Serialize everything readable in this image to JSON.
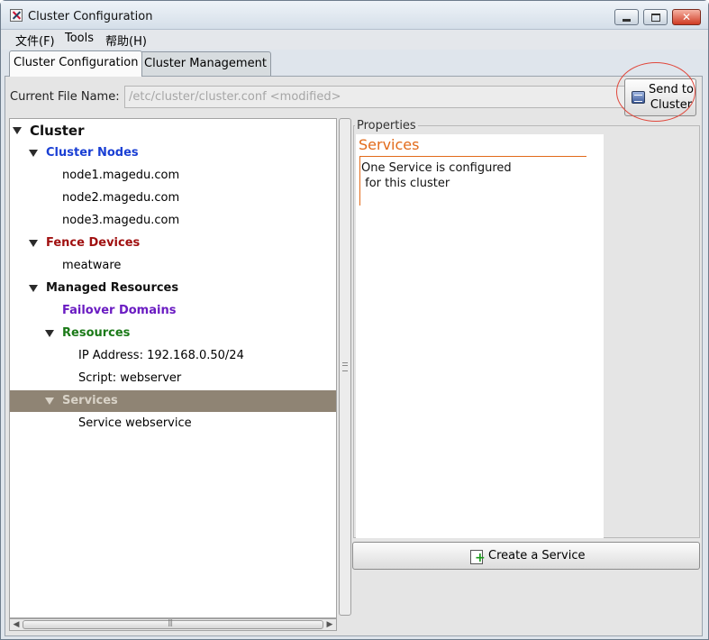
{
  "window": {
    "title": "Cluster Configuration"
  },
  "menu": {
    "items": [
      {
        "label": "文件(F)"
      },
      {
        "label": "Tools"
      },
      {
        "label": "帮助(H)"
      }
    ]
  },
  "tabs": [
    {
      "label": "Cluster Configuration",
      "active": true
    },
    {
      "label": "Cluster Management",
      "active": false
    }
  ],
  "file": {
    "label": "Current File Name:",
    "value": "/etc/cluster/cluster.conf <modified>"
  },
  "send_button": {
    "line1": "Send to",
    "line2": "Cluster"
  },
  "tree": {
    "root": "Cluster",
    "cluster_nodes": "Cluster Nodes",
    "nodes": [
      "node1.magedu.com",
      "node2.magedu.com",
      "node3.magedu.com"
    ],
    "fence_devices": "Fence Devices",
    "fence_items": [
      "meatware"
    ],
    "managed_resources": "Managed Resources",
    "failover_domains": "Failover Domains",
    "resources": "Resources",
    "resource_items": [
      "IP Address:  192.168.0.50/24",
      "Script:  webserver"
    ],
    "services": "Services",
    "service_items": [
      "Service webservice"
    ],
    "selected": "Services"
  },
  "properties": {
    "group_title": "Properties",
    "heading": "Services",
    "line1": "One Service is configured",
    "line2": " for this cluster"
  },
  "create_button": {
    "label": "Create a Service"
  },
  "colors": {
    "cluster_nodes": "#1a3fd4",
    "fence_devices": "#a01010",
    "failover_domains": "#6a1bc2",
    "resources": "#1b7a18",
    "selected_row": "#8f8474",
    "properties_accent": "#e26a1a"
  },
  "icons": {
    "app": "cluster-config-app-icon",
    "send": "send-to-cluster-icon",
    "create": "add-service-icon",
    "expander": "triangle-down-icon"
  }
}
